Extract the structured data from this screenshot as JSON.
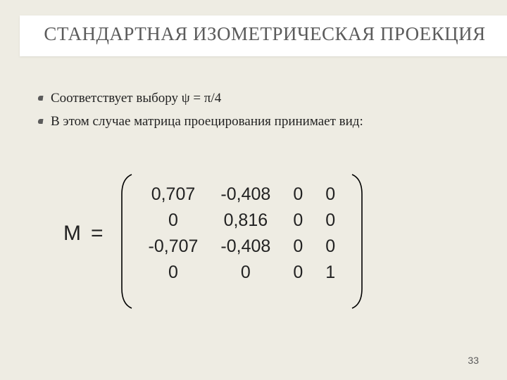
{
  "title": "СТАНДАРТНАЯ ИЗОМЕТРИЧЕСКАЯ ПРОЕКЦИЯ",
  "bullets": [
    "Соответствует выбору ψ = π/4",
    "В этом случае матрица проецирования принимает вид:"
  ],
  "matrix": {
    "label": "M",
    "equals": "=",
    "rows": [
      [
        "0,707",
        "-0,408",
        "0",
        "0"
      ],
      [
        "0",
        "0,816",
        "0",
        "0"
      ],
      [
        "-0,707",
        "-0,408",
        "0",
        "0"
      ],
      [
        "0",
        "0",
        "0",
        "1"
      ]
    ]
  },
  "page_number": "33"
}
